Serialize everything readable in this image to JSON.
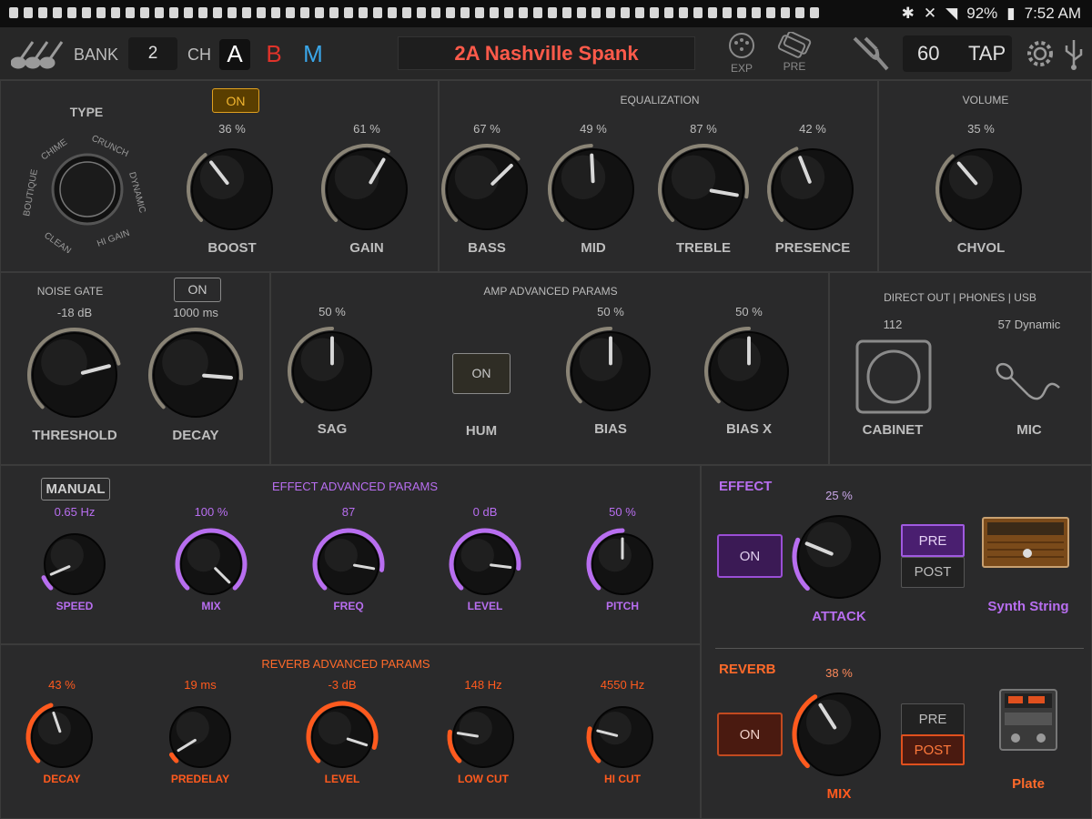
{
  "status": {
    "battery": "92%",
    "time": "7:52 AM",
    "icons": [
      "bluetooth-icon",
      "mute-icon",
      "wifi-icon"
    ]
  },
  "topbar": {
    "bank_label": "BANK",
    "bank_value": "2",
    "ch_label": "CH",
    "ch_a": "A",
    "ch_b": "B",
    "ch_m": "M",
    "preset_name": "2A Nashville Spank",
    "exp_label": "EXP",
    "pre_label": "PRE",
    "tempo_value": "60",
    "tap_label": "TAP"
  },
  "amp": {
    "type_title": "TYPE",
    "types": [
      "BOUTIQUE",
      "CHIME",
      "CRUNCH",
      "DYNAMIC",
      "HI GAIN",
      "CLEAN"
    ],
    "boost_on": "ON",
    "boost": {
      "label": "BOOST",
      "value": "36 %",
      "level": 0.36
    },
    "gain": {
      "label": "GAIN",
      "value": "61 %",
      "level": 0.61
    },
    "eq_title": "EQUALIZATION",
    "bass": {
      "label": "BASS",
      "value": "67 %",
      "level": 0.67
    },
    "mid": {
      "label": "MID",
      "value": "49 %",
      "level": 0.49
    },
    "treble": {
      "label": "TREBLE",
      "value": "87 %",
      "level": 0.87
    },
    "presence": {
      "label": "PRESENCE",
      "value": "42 %",
      "level": 0.42
    },
    "vol_title": "VOLUME",
    "chvol": {
      "label": "CHVOL",
      "value": "35 %",
      "level": 0.35
    }
  },
  "gate": {
    "title": "NOISE GATE",
    "on": "ON",
    "threshold": {
      "label": "THRESHOLD",
      "value": "-18 dB",
      "level": 0.78
    },
    "decay": {
      "label": "DECAY",
      "value": "1000 ms",
      "level": 0.85
    }
  },
  "advanced": {
    "title": "AMP ADVANCED PARAMS",
    "sag": {
      "label": "SAG",
      "value": "50 %",
      "level": 0.5
    },
    "hum": {
      "label": "HUM",
      "on": "ON"
    },
    "bias": {
      "label": "BIAS",
      "value": "50 %",
      "level": 0.5
    },
    "biasx": {
      "label": "BIAS X",
      "value": "50 %",
      "level": 0.5
    }
  },
  "direct": {
    "title": "DIRECT OUT | PHONES | USB",
    "cabinet": {
      "label": "CABINET",
      "value": "112"
    },
    "mic": {
      "label": "MIC",
      "value": "57 Dynamic"
    }
  },
  "effect_params": {
    "manual": "MANUAL",
    "title": "EFFECT ADVANCED PARAMS",
    "knobs": [
      {
        "label": "SPEED",
        "value": "0.65 Hz",
        "level": 0.08
      },
      {
        "label": "MIX",
        "value": "100 %",
        "level": 1.0
      },
      {
        "label": "FREQ",
        "value": "87",
        "level": 0.87
      },
      {
        "label": "LEVEL",
        "value": "0 dB",
        "level": 0.86
      },
      {
        "label": "PITCH",
        "value": "50 %",
        "level": 0.5
      }
    ]
  },
  "reverb_params": {
    "title": "REVERB ADVANCED PARAMS",
    "knobs": [
      {
        "label": "DECAY",
        "value": "43 %",
        "level": 0.43
      },
      {
        "label": "PREDELAY",
        "value": "19 ms",
        "level": 0.05
      },
      {
        "label": "LEVEL",
        "value": "-3 dB",
        "level": 0.9
      },
      {
        "label": "LOW CUT",
        "value": "148 Hz",
        "level": 0.2
      },
      {
        "label": "HI CUT",
        "value": "4550 Hz",
        "level": 0.22
      }
    ]
  },
  "effect": {
    "title": "EFFECT",
    "on": "ON",
    "pre": "PRE",
    "post": "POST",
    "attack": {
      "label": "ATTACK",
      "value": "25 %",
      "level": 0.25
    },
    "name": "Synth String"
  },
  "reverb": {
    "title": "REVERB",
    "on": "ON",
    "pre": "PRE",
    "post": "POST",
    "mix": {
      "label": "MIX",
      "value": "38 %",
      "level": 0.38
    },
    "name": "Plate"
  },
  "colors": {
    "accent_red": "#ff5a4a",
    "effect_purple": "#b86ef0",
    "reverb_orange": "#ff6a2a",
    "ch_a": "#ffffff",
    "ch_b": "#e0332a",
    "ch_m": "#3aa6e8"
  }
}
